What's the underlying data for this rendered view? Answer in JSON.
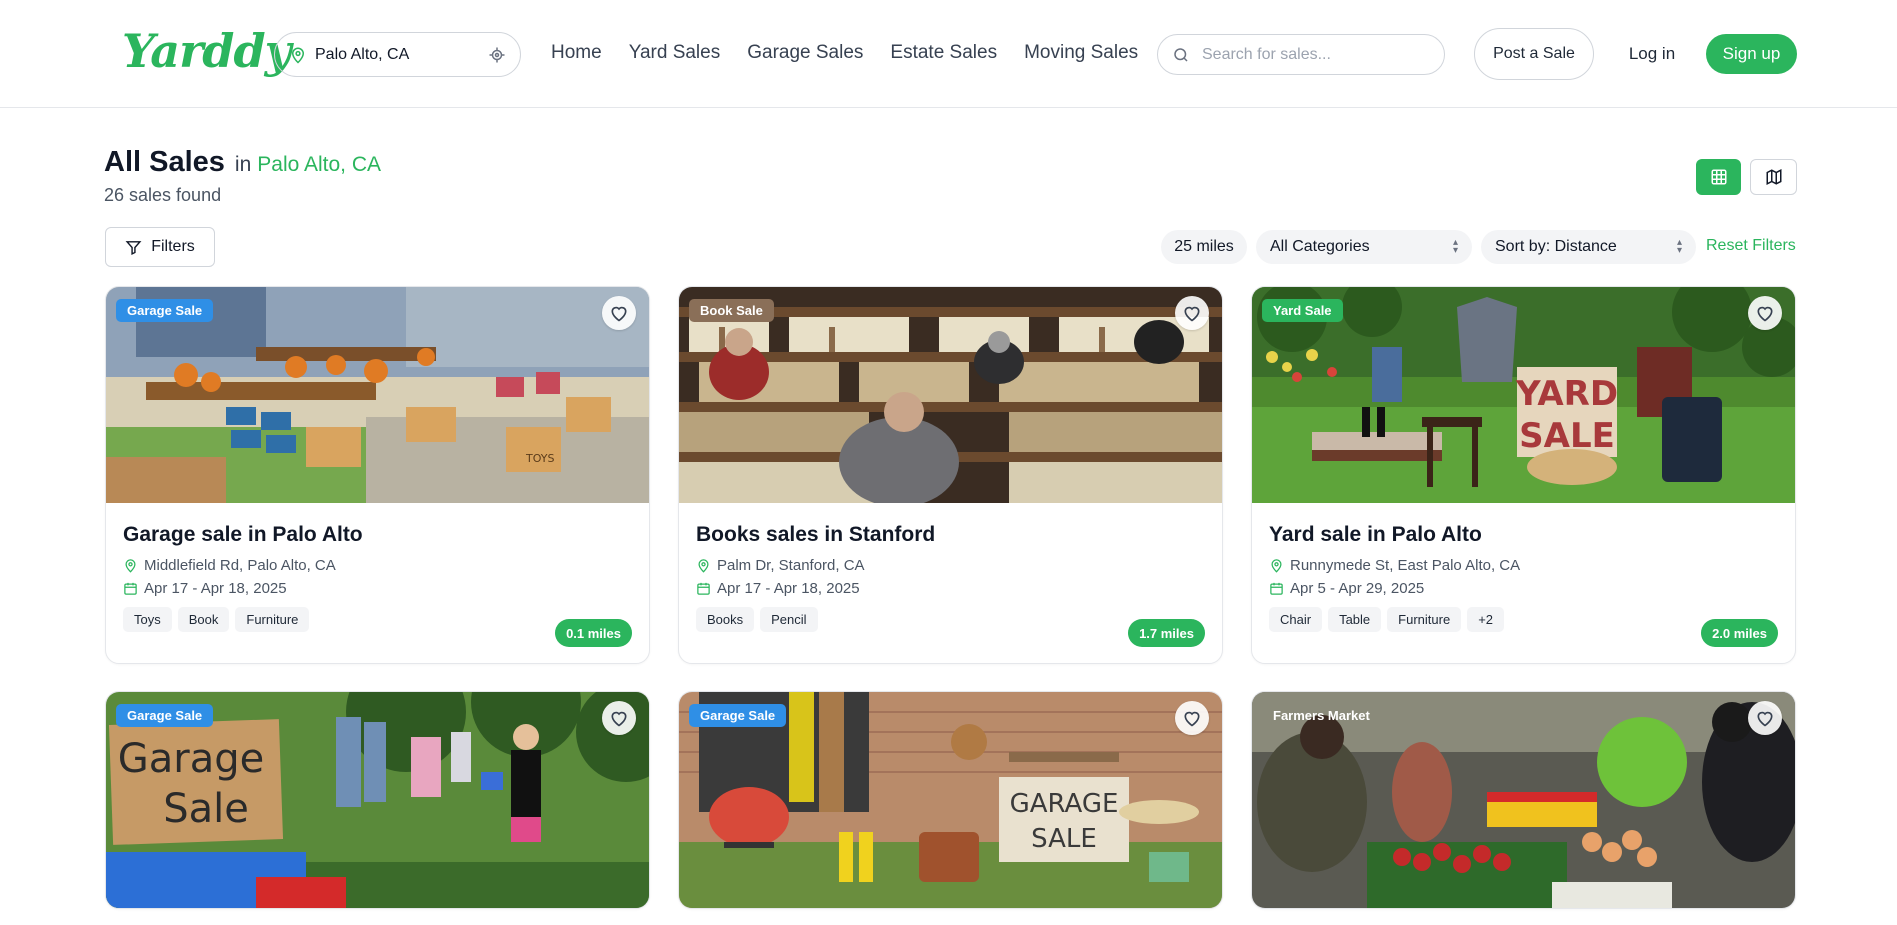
{
  "header": {
    "logo": "Yarddy",
    "location": "Palo Alto, CA",
    "nav": [
      "Home",
      "Yard Sales",
      "Garage Sales",
      "Estate Sales",
      "Moving Sales"
    ],
    "search_placeholder": "Search for sales...",
    "post_label": "Post a Sale",
    "login_label": "Log in",
    "signup_label": "Sign up"
  },
  "main": {
    "title": "All Sales",
    "in_label": "in",
    "city": "Palo Alto, CA",
    "count": "26 sales found"
  },
  "filters": {
    "filters_label": "Filters",
    "miles": "25 miles",
    "category": "All Categories",
    "sort": "Sort by: Distance",
    "reset": "Reset Filters"
  },
  "colors": {
    "brand": "#2bb55d",
    "garage": "#2f8fe6",
    "book": "#8a6f58",
    "yard": "#2bb55d"
  },
  "cards": [
    {
      "badge": "Garage Sale",
      "badge_color": "#2f8fe6",
      "title": "Garage sale in Palo Alto",
      "address": "Middlefield Rd, Palo Alto, CA",
      "dates": "Apr 17 - Apr 18, 2025",
      "tags": [
        "Toys",
        "Book",
        "Furniture"
      ],
      "distance": "0.1 miles"
    },
    {
      "badge": "Book Sale",
      "badge_color": "#8a6f58",
      "title": "Books sales in Stanford",
      "address": "Palm Dr, Stanford, CA",
      "dates": "Apr 17 - Apr 18, 2025",
      "tags": [
        "Books",
        "Pencil"
      ],
      "distance": "1.7 miles"
    },
    {
      "badge": "Yard Sale",
      "badge_color": "#2bb55d",
      "title": "Yard sale in Palo Alto",
      "address": "Runnymede St, East Palo Alto, CA",
      "dates": "Apr 5 - Apr 29, 2025",
      "tags": [
        "Chair",
        "Table",
        "Furniture",
        "+2"
      ],
      "distance": "2.0 miles"
    },
    {
      "badge": "Garage Sale",
      "badge_color": "#2f8fe6"
    },
    {
      "badge": "Garage Sale",
      "badge_color": "#2f8fe6"
    },
    {
      "badge": "Farmers Market",
      "badge_color": "transparent"
    }
  ],
  "image_text": {
    "toys_box": "TOYS",
    "yard_sign_1": "YARD",
    "yard_sign_2": "SALE",
    "garage_sign_1": "Garage",
    "garage_sign_2": "Sale",
    "garage_sign_3": "GARAGE",
    "garage_sign_4": "SALE"
  }
}
